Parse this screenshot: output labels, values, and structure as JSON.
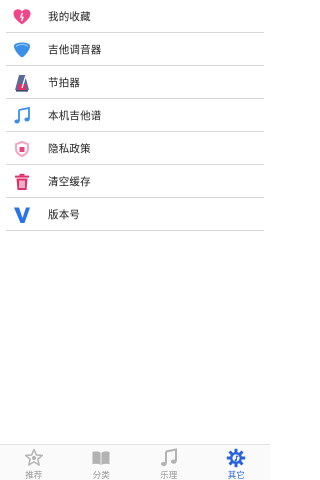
{
  "menu": [
    {
      "label": "我的收藏",
      "icon": "heart-icon"
    },
    {
      "label": "吉他调音器",
      "icon": "guitar-pick-icon"
    },
    {
      "label": "节拍器",
      "icon": "metronome-icon"
    },
    {
      "label": "本机吉他谱",
      "icon": "music-note-icon"
    },
    {
      "label": "隐私政策",
      "icon": "shield-icon"
    },
    {
      "label": "清空缓存",
      "icon": "trash-icon"
    },
    {
      "label": "版本号",
      "icon": "version-v-icon"
    }
  ],
  "tabbar": {
    "tabs": [
      {
        "label": "推荐",
        "icon": "star-icon",
        "active": false
      },
      {
        "label": "分类",
        "icon": "book-icon",
        "active": false
      },
      {
        "label": "乐理",
        "icon": "music-note-icon",
        "active": false
      },
      {
        "label": "其它",
        "icon": "gear-icon",
        "active": true
      }
    ]
  },
  "colors": {
    "accent": "#2a62d9",
    "heart": "#f0478c",
    "pick": "#3a8fe8",
    "trash": "#e0306a",
    "inactive_tab": "#999999"
  }
}
